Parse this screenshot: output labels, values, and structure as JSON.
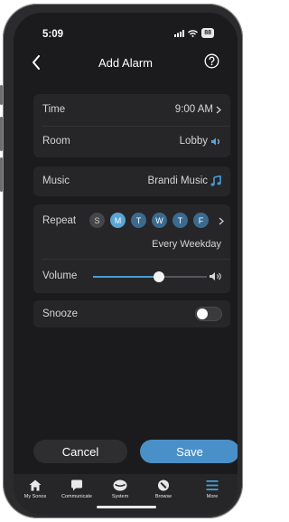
{
  "status_bar": {
    "time": "5:09",
    "battery": "88"
  },
  "nav": {
    "title": "Add Alarm",
    "back_icon": "chevron-left-icon",
    "help_icon": "help-circle-icon"
  },
  "settings": {
    "time": {
      "label": "Time",
      "value": "9:00 AM"
    },
    "room": {
      "label": "Room",
      "value": "Lobby"
    },
    "music": {
      "label": "Music",
      "value": "Brandi Music"
    },
    "repeat": {
      "label": "Repeat",
      "days": [
        {
          "letter": "S",
          "selected": false
        },
        {
          "letter": "M",
          "selected": true
        },
        {
          "letter": "T",
          "selected": true
        },
        {
          "letter": "W",
          "selected": true
        },
        {
          "letter": "T",
          "selected": true
        },
        {
          "letter": "F",
          "selected": true
        }
      ],
      "summary": "Every Weekday"
    },
    "volume": {
      "label": "Volume",
      "level": 0.58
    },
    "snooze": {
      "label": "Snooze",
      "enabled": false
    }
  },
  "actions": {
    "cancel_label": "Cancel",
    "save_label": "Save"
  },
  "tabs": [
    {
      "label": "My Sonos",
      "icon": "home-icon"
    },
    {
      "label": "Communicate",
      "icon": "chat-icon"
    },
    {
      "label": "System",
      "icon": "speaker-icon"
    },
    {
      "label": "Browse",
      "icon": "compass-icon"
    },
    {
      "label": "More",
      "icon": "menu-icon"
    }
  ],
  "colors": {
    "accent": "#4a9bd4",
    "day_selected": "#5aa4d6",
    "day_active": "#3b6a8f",
    "save_button": "#4a90c8",
    "card": "#262628",
    "background": "#1b1b1d"
  }
}
